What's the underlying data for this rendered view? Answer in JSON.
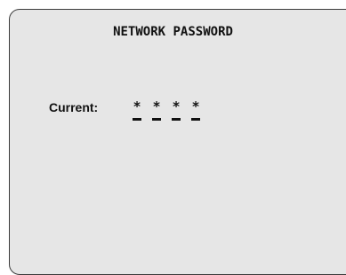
{
  "screen": {
    "title": "NETWORK PASSWORD"
  },
  "password_entry": {
    "label": "Current:",
    "masked_chars": [
      "*",
      "*",
      "*",
      "*"
    ]
  },
  "colors": {
    "panel_background": "#e6e6e6",
    "text": "#111111"
  }
}
